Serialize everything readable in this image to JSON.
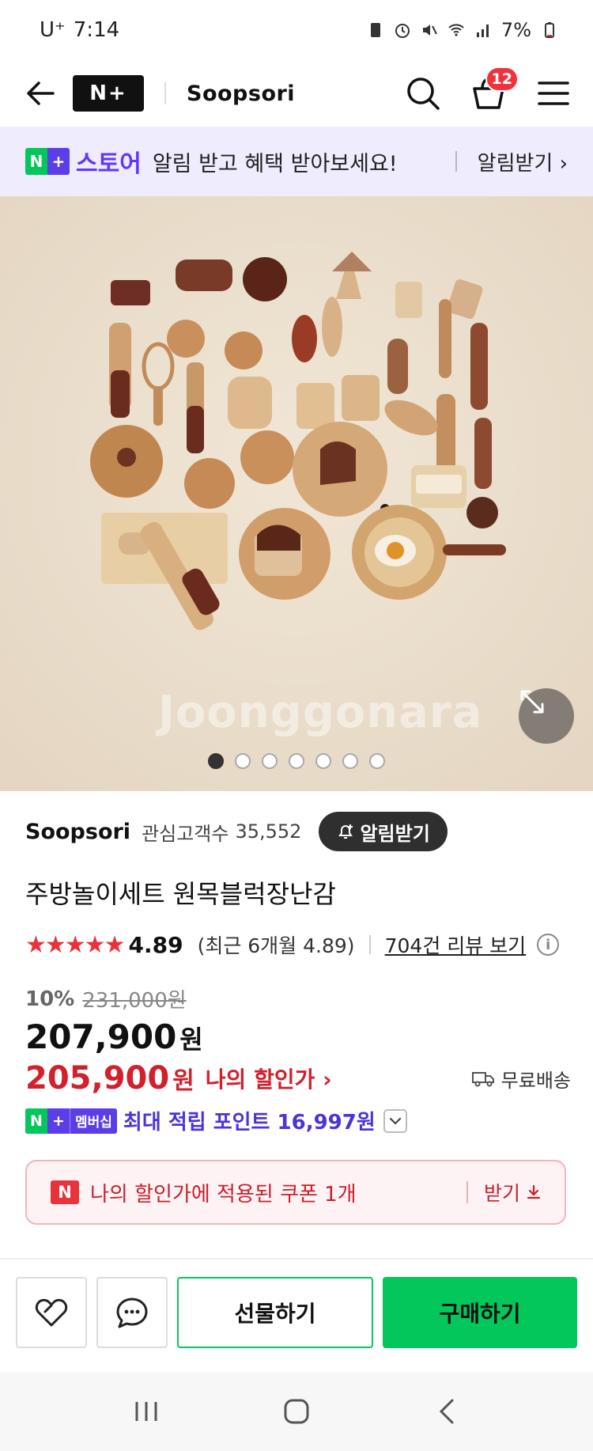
{
  "status_bar": {
    "carrier": "U⁺",
    "time": "7:14",
    "battery": "7%"
  },
  "header": {
    "logo_text": "N+",
    "store_name": "Soopsori",
    "cart_count": "12"
  },
  "notify_banner": {
    "chip_left": "N",
    "chip_right": "+",
    "store_word": "스토어",
    "message": "알림 받고 혜택 받아보세요!",
    "action": "알림받기 ›"
  },
  "gallery": {
    "watermark": "Joonggonara",
    "slide_count": 7,
    "active_index": 0
  },
  "seller": {
    "name": "Soopsori",
    "fan_label": "관심고객수",
    "fan_count": "35,552",
    "alarm_button": "알림받기"
  },
  "product": {
    "title": "주방놀이세트 원목블럭장난감",
    "stars": "★★★★★",
    "rating": "4.89",
    "rating_recent": "(최근 6개월 4.89)",
    "review_link": "704건 리뷰 보기",
    "info_icon_text": "i",
    "discount_rate": "10%",
    "original_price": "231,000원",
    "sale_price": "207,900",
    "currency": "원",
    "my_price": "205,900",
    "my_price_label": "나의 할인가 ›",
    "shipping": "무료배송",
    "membership_chip": "멤버십",
    "points_text": "최대 적립 포인트 16,997원"
  },
  "coupon": {
    "badge": "N",
    "text": "나의 할인가에 적용된 쿠폰 1개",
    "action": "받기"
  },
  "actions": {
    "gift": "선물하기",
    "buy": "구매하기"
  }
}
